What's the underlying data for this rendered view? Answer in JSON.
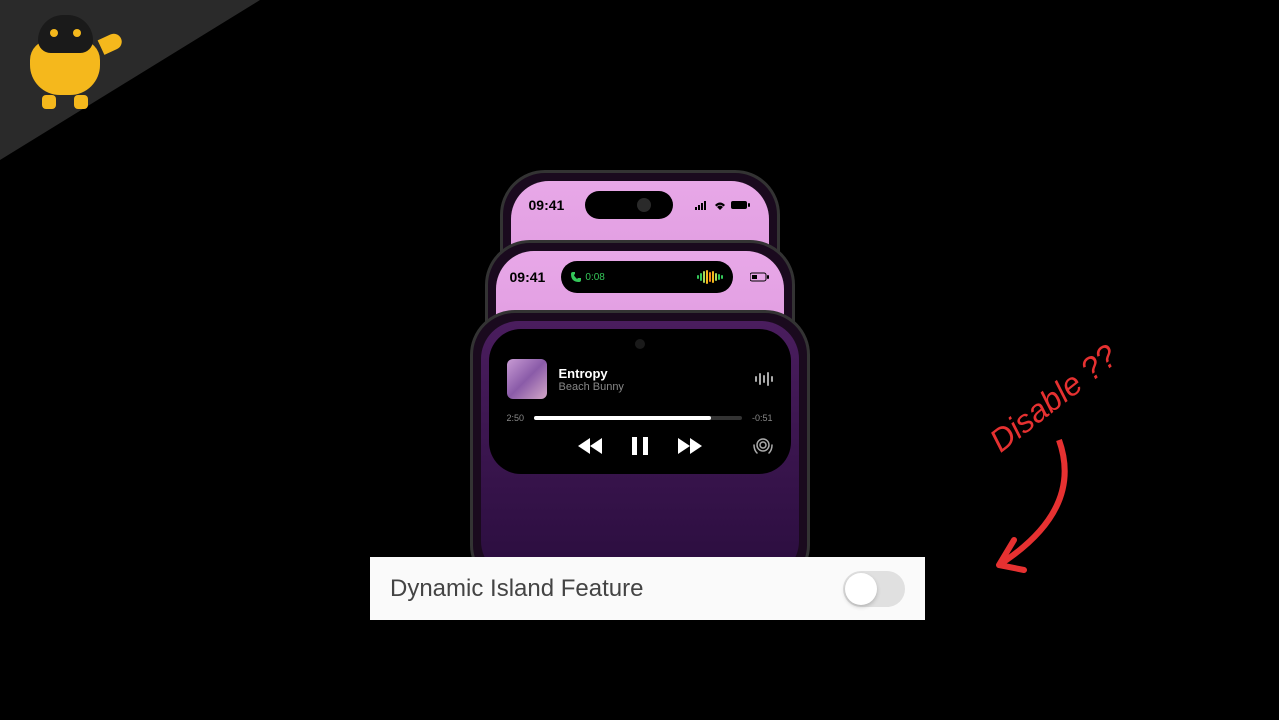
{
  "phones": {
    "phone1": {
      "time": "09:41"
    },
    "phone2": {
      "time": "09:41",
      "callDuration": "0:08"
    },
    "phone3": {
      "trackTitle": "Entropy",
      "trackArtist": "Beach Bunny",
      "elapsed": "2:50",
      "remaining": "-0:51"
    }
  },
  "settings": {
    "label": "Dynamic Island Feature",
    "toggleState": "off"
  },
  "annotation": {
    "text": "Disable ??"
  }
}
